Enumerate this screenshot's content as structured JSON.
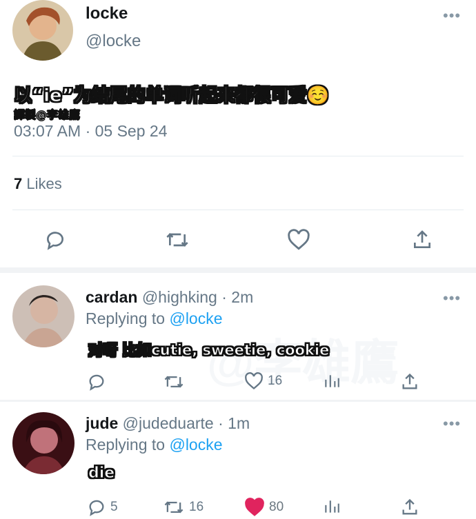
{
  "main_tweet": {
    "display_name": "locke",
    "handle": "@locke",
    "text": "以“ie”为结尾的单词听起来都很可爱☺️",
    "translator_credit": "譯製@李雄鷹",
    "timestamp": "03:07 AM · 05 Sep 24",
    "likes_count": "7",
    "likes_label": "Likes"
  },
  "replies": [
    {
      "display_name": "cardan",
      "handle": "@highking",
      "time": "· 2m",
      "replying_prefix": "Replying to",
      "replying_to": "@locke",
      "text": "对呀 比如cutie, sweetie, cookie",
      "reply_count": "",
      "retweet_count": "",
      "like_count": "16",
      "liked": false
    },
    {
      "display_name": "jude",
      "handle": "@judeduarte",
      "time": "· 1m",
      "replying_prefix": "Replying to",
      "replying_to": "@locke",
      "text": "die",
      "reply_count": "5",
      "retweet_count": "16",
      "like_count": "80",
      "liked": true
    }
  ],
  "colors": {
    "link": "#1da1f2",
    "like_active": "#e0245e",
    "muted": "#657786"
  },
  "icons": [
    "reply-icon",
    "retweet-icon",
    "like-icon",
    "share-icon",
    "analytics-icon",
    "more-icon"
  ]
}
